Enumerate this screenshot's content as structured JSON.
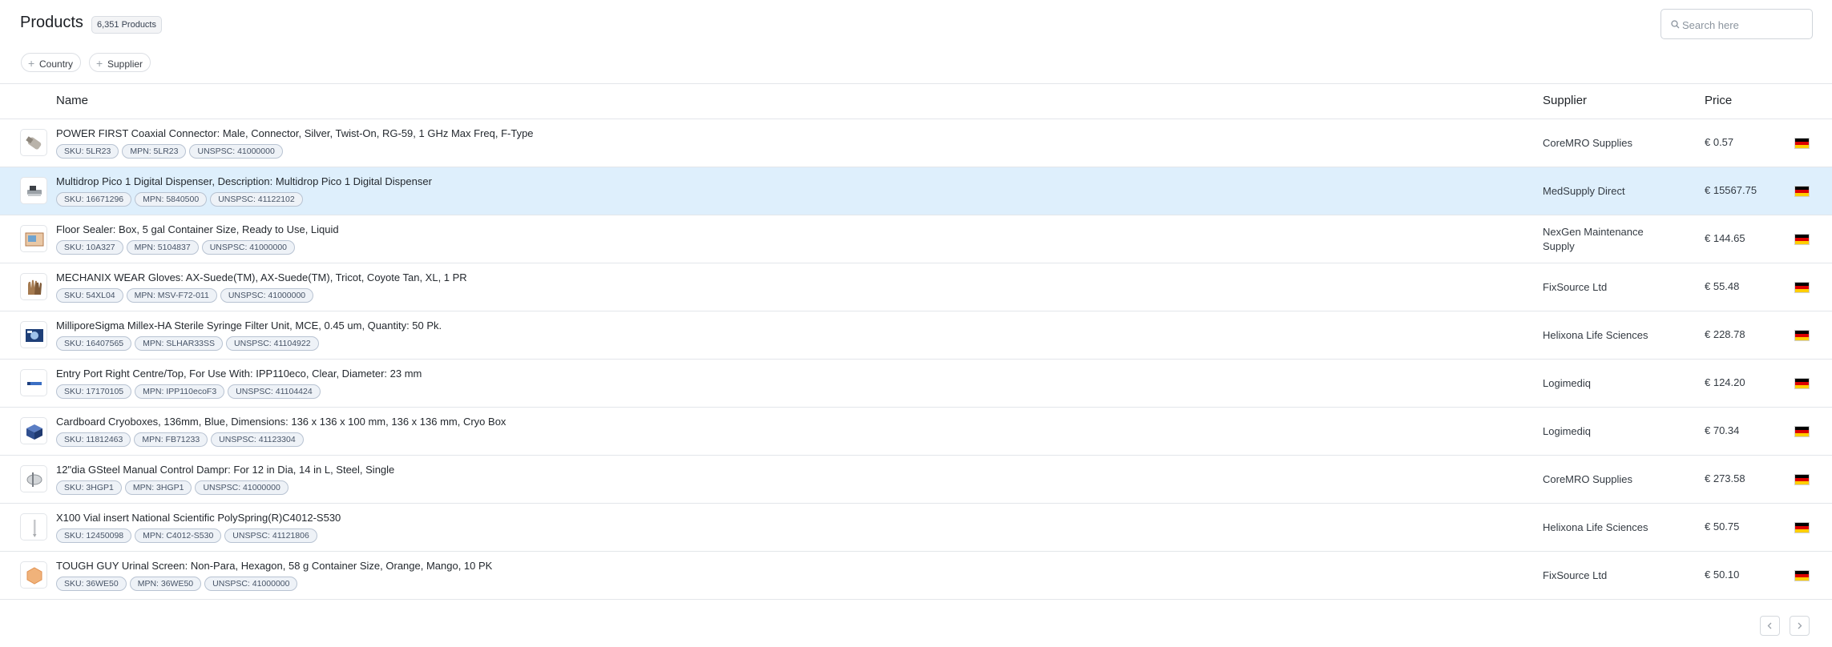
{
  "page": {
    "title": "Products",
    "count_badge": "6,351 Products",
    "search_placeholder": "Search here"
  },
  "filters": [
    {
      "label": "Country"
    },
    {
      "label": "Supplier"
    }
  ],
  "table": {
    "columns": [
      "Name",
      "Supplier",
      "Price"
    ],
    "rows": [
      {
        "name": "POWER FIRST Coaxial Connector: Male, Connector, Silver, Twist-On, RG-59, 1 GHz Max Freq, F-Type",
        "sku": "SKU: 5LR23",
        "mpn": "MPN: 5LR23",
        "unspsc": "UNSPSC: 41000000",
        "supplier": "CoreMRO Supplies",
        "price": "€ 0.57",
        "thumb_icon": "coax-connector-icon",
        "country_flag": "germany-flag"
      },
      {
        "name": "Multidrop Pico 1 Digital Dispenser, Description: Multidrop Pico 1 Digital Dispenser",
        "sku": "SKU: 16671296",
        "mpn": "MPN: 5840500",
        "unspsc": "UNSPSC: 41122102",
        "supplier": "MedSupply Direct",
        "price": "€ 15567.75",
        "thumb_icon": "dispenser-icon",
        "country_flag": "germany-flag"
      },
      {
        "name": "Floor Sealer: Box, 5 gal Container Size, Ready to Use, Liquid",
        "sku": "SKU: 10A327",
        "mpn": "MPN: 5104837",
        "unspsc": "UNSPSC: 41000000",
        "supplier": "NexGen Maintenance Supply",
        "price": "€ 144.65",
        "thumb_icon": "box-icon",
        "country_flag": "germany-flag"
      },
      {
        "name": "MECHANIX WEAR Gloves: AX-Suede(TM), AX-Suede(TM), Tricot, Coyote Tan, XL, 1 PR",
        "sku": "SKU: 54XL04",
        "mpn": "MPN: MSV-F72-011",
        "unspsc": "UNSPSC: 41000000",
        "supplier": "FixSource Ltd",
        "price": "€ 55.48",
        "thumb_icon": "gloves-icon",
        "country_flag": "germany-flag"
      },
      {
        "name": "MilliporeSigma Millex-HA Sterile Syringe Filter Unit, MCE, 0.45 um, Quantity: 50 Pk.",
        "sku": "SKU: 16407565",
        "mpn": "MPN: SLHAR33SS",
        "unspsc": "UNSPSC: 41104922",
        "supplier": "Helixona Life Sciences",
        "price": "€ 228.78",
        "thumb_icon": "filter-unit-icon",
        "country_flag": "germany-flag"
      },
      {
        "name": "Entry Port Right Centre/Top, For Use With: IPP110eco, Clear, Diameter: 23 mm",
        "sku": "SKU: 17170105",
        "mpn": "MPN: IPP110ecoF3",
        "unspsc": "UNSPSC: 41104424",
        "supplier": "Logimediq",
        "price": "€ 124.20",
        "thumb_icon": "brand-logo-icon",
        "country_flag": "germany-flag"
      },
      {
        "name": "Cardboard Cryoboxes, 136mm, Blue, Dimensions: 136 x 136 x 100 mm, 136 x 136 mm, Cryo Box",
        "sku": "SKU: 11812463",
        "mpn": "MPN: FB71233",
        "unspsc": "UNSPSC: 41123304",
        "supplier": "Logimediq",
        "price": "€ 70.34",
        "thumb_icon": "cryobox-icon",
        "country_flag": "germany-flag"
      },
      {
        "name": "12\"dia GSteel Manual Control Dampr: For 12 in Dia, 14 in L, Steel, Single",
        "sku": "SKU: 3HGP1",
        "mpn": "MPN: 3HGP1",
        "unspsc": "UNSPSC: 41000000",
        "supplier": "CoreMRO Supplies",
        "price": "€ 273.58",
        "thumb_icon": "damper-icon",
        "country_flag": "germany-flag"
      },
      {
        "name": "X100 Vial insert National Scientific PolySpring(R)C4012-S530",
        "sku": "SKU: 12450098",
        "mpn": "MPN: C4012-S530",
        "unspsc": "UNSPSC: 41121806",
        "supplier": "Helixona Life Sciences",
        "price": "€ 50.75",
        "thumb_icon": "vial-insert-icon",
        "country_flag": "germany-flag"
      },
      {
        "name": "TOUGH GUY Urinal Screen: Non-Para, Hexagon, 58 g Container Size, Orange, Mango, 10 PK",
        "sku": "SKU: 36WE50",
        "mpn": "MPN: 36WE50",
        "unspsc": "UNSPSC: 41000000",
        "supplier": "FixSource Ltd",
        "price": "€ 50.10",
        "thumb_icon": "urinal-screen-icon",
        "country_flag": "germany-flag"
      }
    ]
  },
  "pagination": {
    "prev_icon": "chevron-left-icon",
    "next_icon": "chevron-right-icon"
  },
  "colors": {
    "selected_row": "#deeffc",
    "tag_border": "#b8c3d2",
    "flag_black": "#000000",
    "flag_red": "#dd0000",
    "flag_gold": "#ffce00"
  }
}
